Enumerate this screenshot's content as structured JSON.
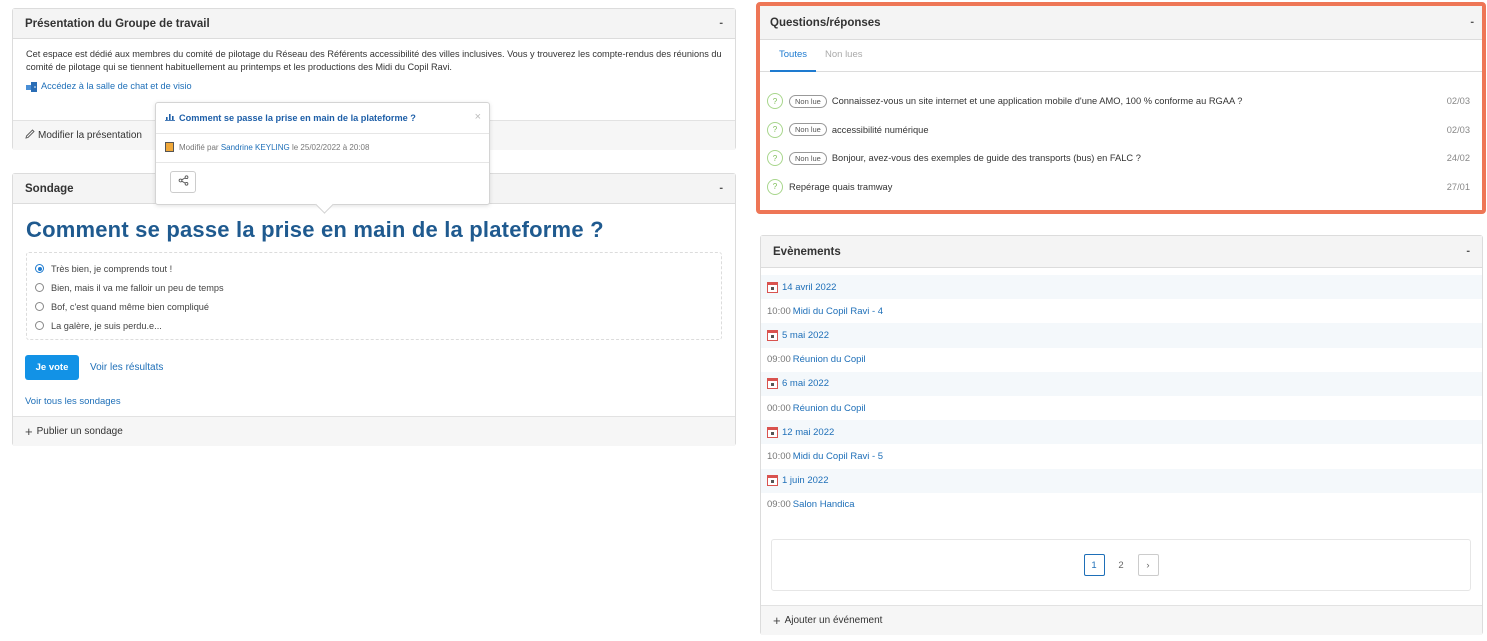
{
  "presentation": {
    "title": "Présentation du Groupe de travail",
    "collapse": "-",
    "text": "Cet espace est dédié aux membres du comité de pilotage du Réseau des Référents accessibilité des villes inclusives. Vous y trouverez les compte-rendus des réunions du comité de pilotage qui se tiennent habituellement au printemps et les productions des Midi du Copil Ravi.",
    "chat_link": "Accédez à la salle de chat et de visio",
    "edit_label": "Modifier la présentation"
  },
  "popup": {
    "title": "Comment se passe la prise en main de la plateforme ?",
    "close": "×",
    "modified_prefix": "Modifié par",
    "author": "Sandrine KEYLING",
    "modified_suffix": "le 25/02/2022 à 20:08",
    "share_icon": "share-icon"
  },
  "poll": {
    "title": "Sondage",
    "collapse": "-",
    "question": "Comment se passe la prise en main de la plateforme ?",
    "options": [
      {
        "label": "Très bien, je comprends tout !",
        "selected": true
      },
      {
        "label": "Bien, mais il va me falloir un peu de temps",
        "selected": false
      },
      {
        "label": "Bof, c'est quand même bien compliqué",
        "selected": false
      },
      {
        "label": "La galère, je suis perdu.e...",
        "selected": false
      }
    ],
    "vote_label": "Je vote",
    "results_label": "Voir les résultats",
    "all_label": "Voir tous les sondages",
    "publish_label": "Publier un sondage",
    "plus": "+"
  },
  "qa": {
    "title": "Questions/réponses",
    "collapse": "-",
    "tabs": [
      "Toutes",
      "Non lues"
    ],
    "qmark": "?",
    "items": [
      {
        "badge": "Non lue",
        "text": "Connaissez-vous un site internet et une application mobile d'une AMO, 100 % conforme au RGAA ?",
        "date": "02/03"
      },
      {
        "badge": "Non lue",
        "text": "accessibilité numérique",
        "date": "02/03"
      },
      {
        "badge": "Non lue",
        "text": "Bonjour, avez-vous des exemples de guide des transports (bus) en FALC ?",
        "date": "24/02"
      },
      {
        "badge": "",
        "text": "Repérage quais tramway",
        "date": "27/01"
      }
    ]
  },
  "events": {
    "title": "Evènements",
    "collapse": "-",
    "items": [
      {
        "date": "14 avril 2022",
        "time": "10:00",
        "name": "Midi du Copil Ravi - 4"
      },
      {
        "date": "5 mai 2022",
        "time": "09:00",
        "name": "Réunion du Copil"
      },
      {
        "date": "6 mai 2022",
        "time": "00:00",
        "name": "Réunion du Copil"
      },
      {
        "date": "12 mai 2022",
        "time": "10:00",
        "name": "Midi du Copil Ravi - 5"
      },
      {
        "date": "1 juin 2022",
        "time": "09:00",
        "name": "Salon Handica"
      }
    ],
    "pages": [
      "1",
      "2"
    ],
    "next": "›",
    "add_label": "Ajouter un événement",
    "plus": "+"
  },
  "colors": {
    "highlight": "#ee7656",
    "link": "#1e6fb8",
    "button": "#1292e6",
    "question_title": "#1f5a8f"
  }
}
